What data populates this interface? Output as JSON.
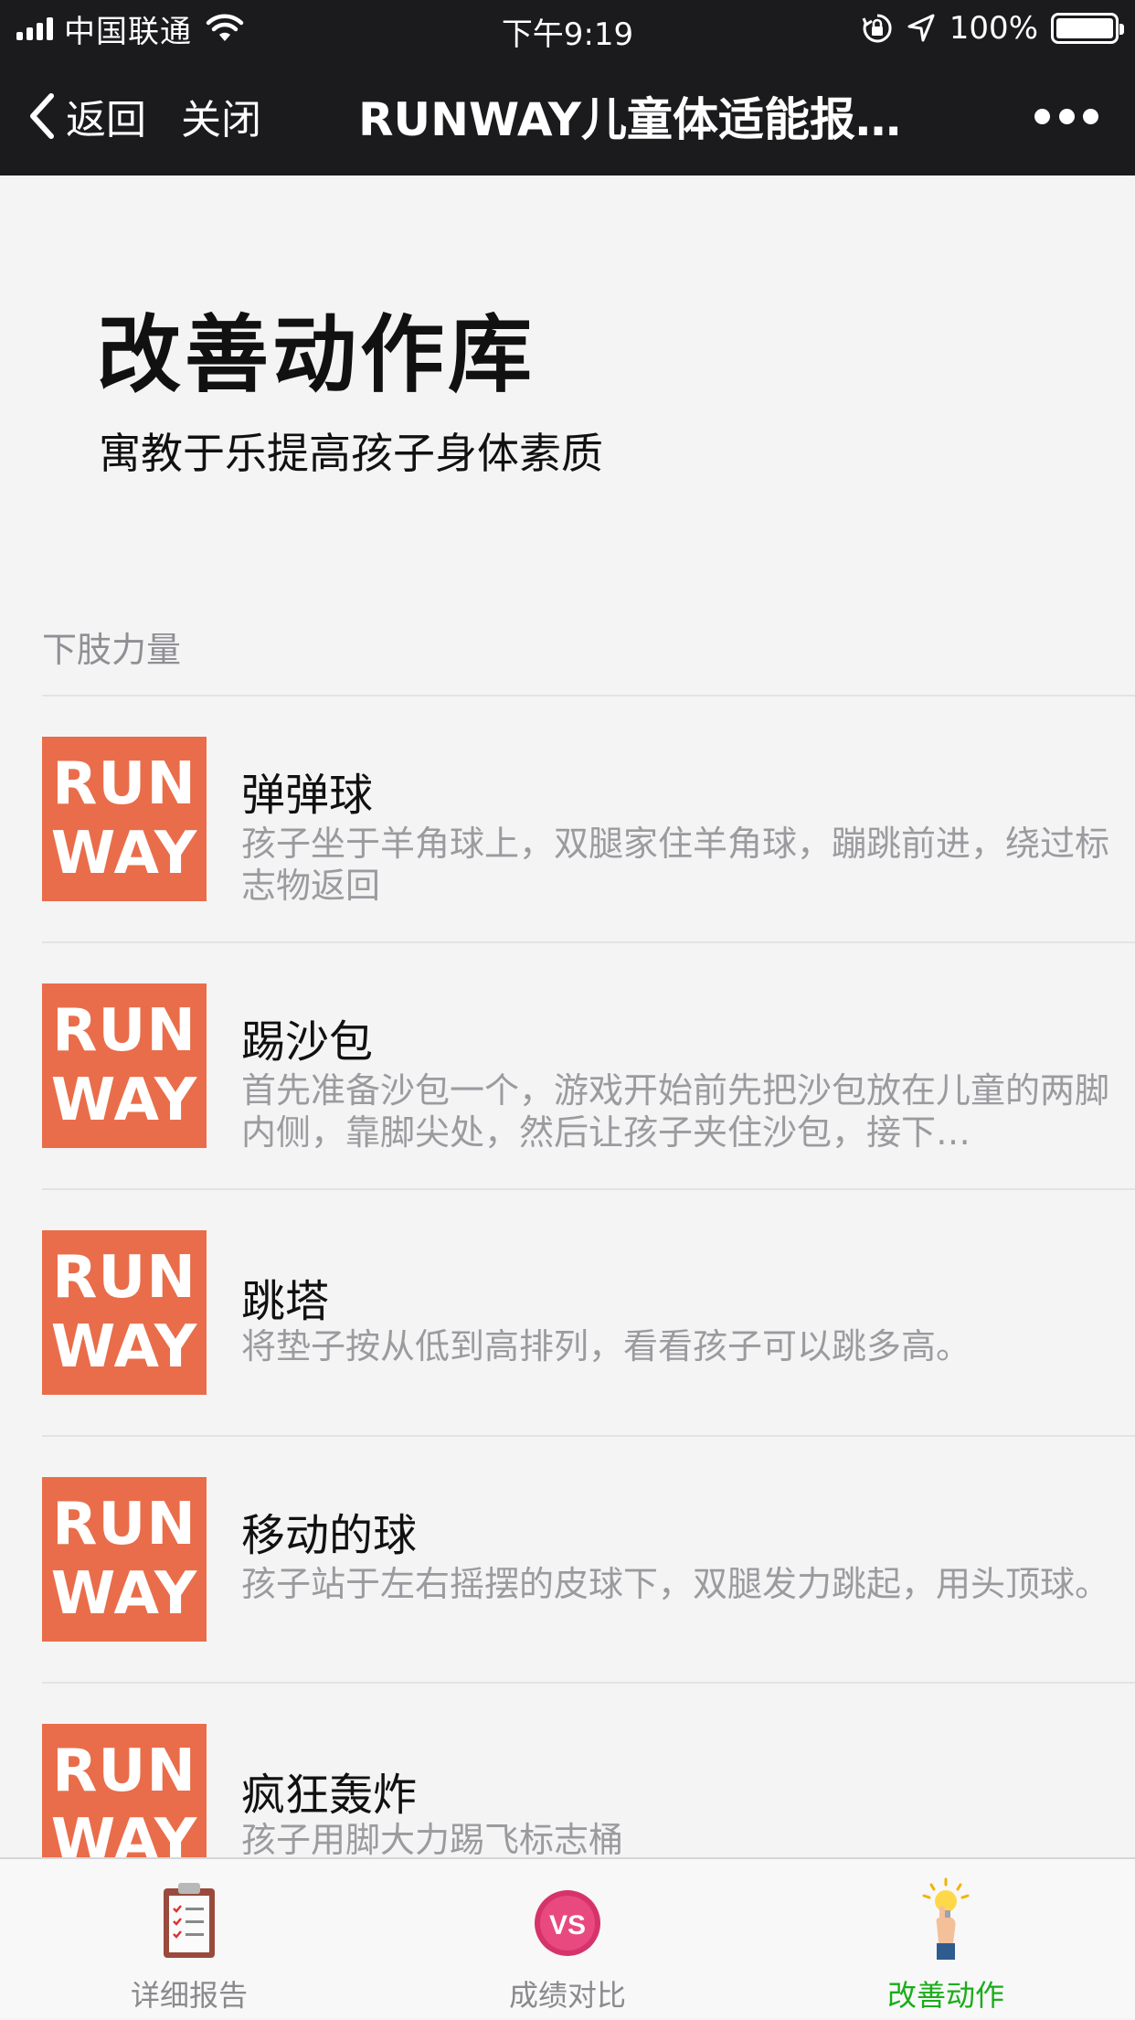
{
  "status_bar": {
    "carrier": "中国联通",
    "time": "下午9:19",
    "battery": "100%"
  },
  "nav": {
    "back_label": "返回",
    "close_label": "关闭",
    "title": "RUNWAY儿童体适能报…"
  },
  "hero": {
    "title": "改善动作库",
    "subtitle": "寓教于乐提高孩子身体素质"
  },
  "section": {
    "label": "下肢力量"
  },
  "items": [
    {
      "thumb_line1": "RUN",
      "thumb_line2": "WAY",
      "title": "弹弹球",
      "desc": "孩子坐于羊角球上，双腿家住羊角球，蹦跳前进，绕过标志物返回"
    },
    {
      "thumb_line1": "RUN",
      "thumb_line2": "WAY",
      "title": "踢沙包",
      "desc": "首先准备沙包一个，游戏开始前先把沙包放在儿童的两脚内侧，靠脚尖处，然后让孩子夹住沙包，接下…"
    },
    {
      "thumb_line1": "RUN",
      "thumb_line2": "WAY",
      "title": "跳塔",
      "desc": "将垫子按从低到高排列，看看孩子可以跳多高。"
    },
    {
      "thumb_line1": "RUN",
      "thumb_line2": "WAY",
      "title": "移动的球",
      "desc": "孩子站于左右摇摆的皮球下，双腿发力跳起，用头顶球。"
    },
    {
      "thumb_line1": "RUN",
      "thumb_line2": "WAY",
      "title": "疯狂轰炸",
      "desc": "孩子用脚大力踢飞标志桶"
    }
  ],
  "tabbar": {
    "tabs": [
      {
        "label": "详细报告",
        "icon": "clipboard-icon"
      },
      {
        "label": "成绩对比",
        "icon": "vs-badge-icon",
        "badge_text": "VS"
      },
      {
        "label": "改善动作",
        "icon": "idea-hand-icon",
        "active": true
      }
    ],
    "active_color": "#1aad19"
  },
  "colors": {
    "nav_bg": "#1b1b1d",
    "thumb_bg": "#e96d4a",
    "page_bg": "#f4f4f5"
  }
}
